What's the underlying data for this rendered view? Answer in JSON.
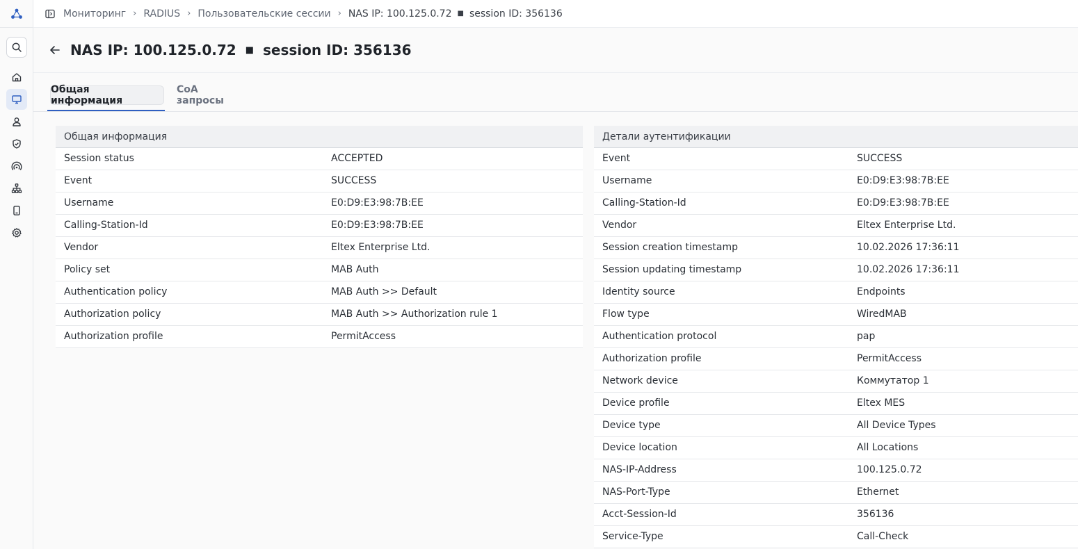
{
  "breadcrumb": {
    "items": [
      "Мониторинг",
      "RADIUS",
      "Пользовательские сессии"
    ],
    "current_nas": "NAS IP: 100.125.0.72",
    "current_session": "session ID: 356136"
  },
  "title": {
    "nas": "NAS IP: 100.125.0.72",
    "session": "session ID: 356136"
  },
  "tabs": [
    {
      "label": "Общая информация",
      "active": true
    },
    {
      "label": "CoA запросы",
      "active": false
    }
  ],
  "sidebar": {
    "icons": [
      "logo-icon",
      "search-icon",
      "home-icon",
      "monitor-icon",
      "user-icon",
      "shield-icon",
      "radio-icon",
      "network-icon",
      "device-icon",
      "gear-icon"
    ]
  },
  "colors": {
    "accent": "#2f5fc1",
    "sidebar_active": "#e3eaf7"
  },
  "general": {
    "title": "Общая информация",
    "rows": [
      {
        "k": "Session status",
        "v": "ACCEPTED"
      },
      {
        "k": "Event",
        "v": "SUCCESS"
      },
      {
        "k": "Username",
        "v": "E0:D9:E3:98:7B:EE"
      },
      {
        "k": "Calling-Station-Id",
        "v": "E0:D9:E3:98:7B:EE"
      },
      {
        "k": "Vendor",
        "v": "Eltex Enterprise Ltd."
      },
      {
        "k": "Policy set",
        "v": "MAB Auth"
      },
      {
        "k": "Authentication policy",
        "v": "MAB Auth >> Default"
      },
      {
        "k": "Authorization policy",
        "v": "MAB Auth >> Authorization rule 1"
      },
      {
        "k": "Authorization profile",
        "v": "PermitAccess"
      }
    ]
  },
  "auth": {
    "title": "Детали аутентификации",
    "rows": [
      {
        "k": "Event",
        "v": "SUCCESS"
      },
      {
        "k": "Username",
        "v": "E0:D9:E3:98:7B:EE"
      },
      {
        "k": "Calling-Station-Id",
        "v": "E0:D9:E3:98:7B:EE"
      },
      {
        "k": "Vendor",
        "v": "Eltex Enterprise Ltd."
      },
      {
        "k": "Session creation timestamp",
        "v": "10.02.2026 17:36:11"
      },
      {
        "k": "Session updating timestamp",
        "v": "10.02.2026 17:36:11"
      },
      {
        "k": "Identity source",
        "v": "Endpoints"
      },
      {
        "k": "Flow type",
        "v": "WiredMAB"
      },
      {
        "k": "Authentication protocol",
        "v": "pap"
      },
      {
        "k": "Authorization profile",
        "v": "PermitAccess"
      },
      {
        "k": "Network device",
        "v": "Коммутатор 1"
      },
      {
        "k": "Device profile",
        "v": "Eltex MES"
      },
      {
        "k": "Device type",
        "v": "All Device Types"
      },
      {
        "k": "Device location",
        "v": "All Locations"
      },
      {
        "k": "NAS-IP-Address",
        "v": "100.125.0.72"
      },
      {
        "k": "NAS-Port-Type",
        "v": "Ethernet"
      },
      {
        "k": "Acct-Session-Id",
        "v": "356136"
      },
      {
        "k": "Service-Type",
        "v": "Call-Check"
      }
    ]
  }
}
